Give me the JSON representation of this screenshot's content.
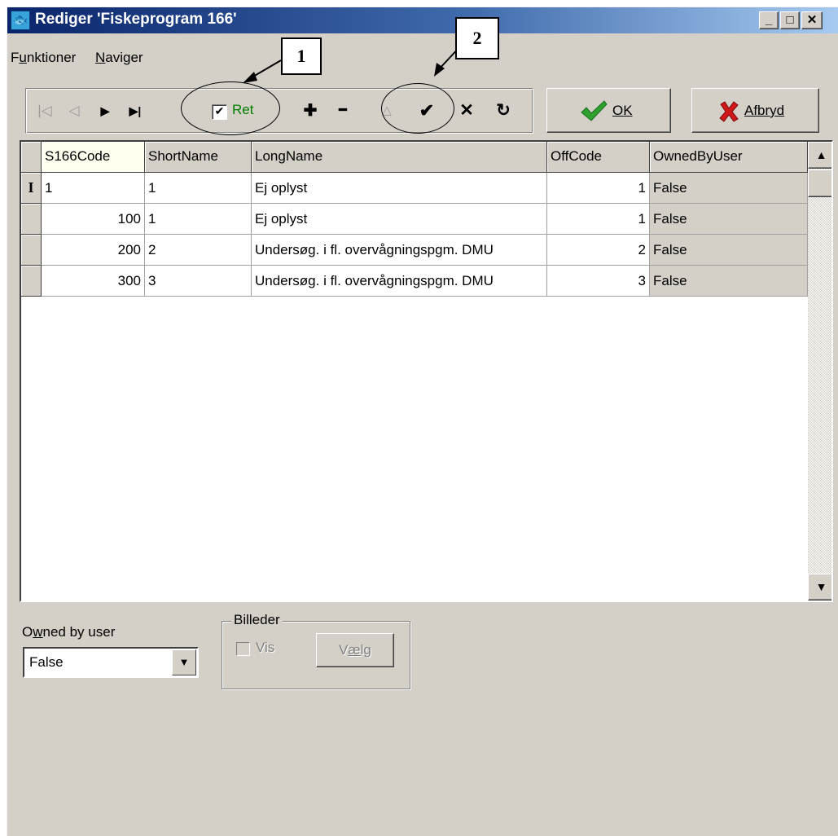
{
  "window": {
    "title": "Rediger 'Fiskeprogram 166'",
    "controls": {
      "minimize": "_",
      "maximize": "□",
      "close": "✕"
    }
  },
  "menu": {
    "items": [
      {
        "label": "Funktioner",
        "mnemonic": "u"
      },
      {
        "label": "Naviger",
        "mnemonic": "N"
      }
    ]
  },
  "navigator": {
    "first": "|◁",
    "prior": "◁",
    "next": "▶",
    "last": "▶|",
    "edit_label": "Ret",
    "edit_checked": "✔",
    "insert": "✚",
    "delete": "━",
    "edit_arrow": "△",
    "post": "✔",
    "cancel": "✕",
    "refresh": "↻"
  },
  "buttons": {
    "ok_label": "OK",
    "cancel_label": "Afbryd",
    "ok_color": "#2fa02f",
    "cancel_color": "#d01818"
  },
  "annotations": {
    "label1": "1",
    "label2": "2"
  },
  "grid": {
    "columns": [
      "S166Code",
      "ShortName",
      "LongName",
      "OffCode",
      "OwnedByUser"
    ],
    "rows": [
      {
        "indicator": "I",
        "S166Code": "1",
        "ShortName": "1",
        "LongName": "Ej oplyst",
        "OffCode": "1",
        "OwnedByUser": "False"
      },
      {
        "indicator": "",
        "S166Code": "100",
        "ShortName": "1",
        "LongName": "Ej oplyst",
        "OffCode": "1",
        "OwnedByUser": "False"
      },
      {
        "indicator": "",
        "S166Code": "200",
        "ShortName": "2",
        "LongName": "Undersøg. i fl. overvågningspgm. DMU",
        "OffCode": "2",
        "OwnedByUser": "False"
      },
      {
        "indicator": "",
        "S166Code": "300",
        "ShortName": "3",
        "LongName": "Undersøg. i fl. overvågningspgm. DMU",
        "OffCode": "3",
        "OwnedByUser": "False"
      }
    ],
    "scroll_up": "▲",
    "scroll_down": "▼"
  },
  "owned_filter": {
    "label": "Owned by user",
    "value": "False",
    "arrow": "▼"
  },
  "pictures": {
    "group_title": "Billeder",
    "show_label": "Vis",
    "choose_label": "Vælg"
  }
}
